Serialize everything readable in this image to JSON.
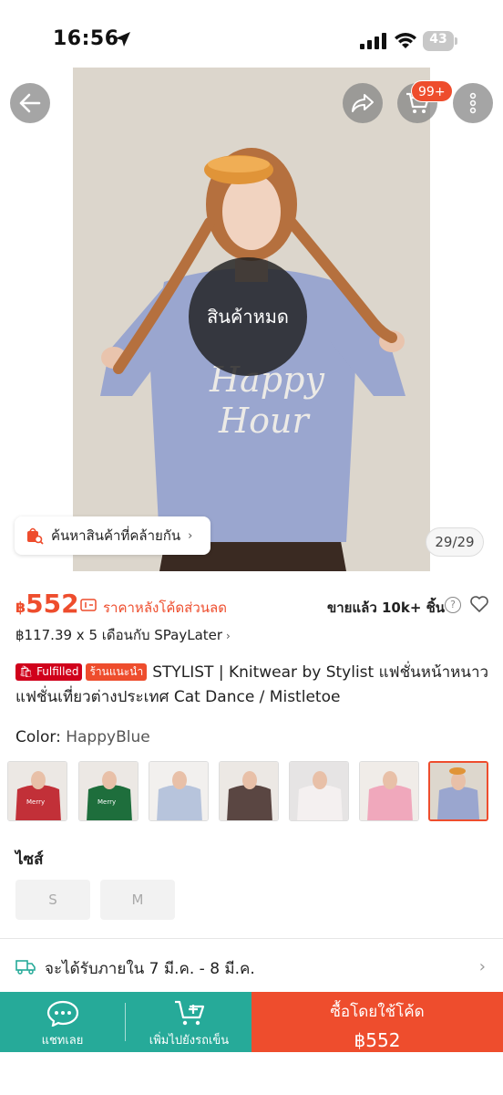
{
  "status": {
    "time": "16:56",
    "battery": "43"
  },
  "header": {
    "cart_badge": "99+"
  },
  "image": {
    "soldout_text": "สินค้าหมด",
    "similar_search": "ค้นหาสินค้าที่คล้ายกัน",
    "counter": "29/29"
  },
  "price": {
    "currency": "฿",
    "amount": "552",
    "after_code_label": "ราคาหลังโค้ดส่วนลด",
    "sold_text": "ขายแล้ว 10k+ ชิ้น",
    "installment": "฿117.39 x 5 เดือนกับ SPayLater"
  },
  "product": {
    "tag_fulfilled": "Fulfilled",
    "tag_recommended": "ร้านแนะนำ",
    "title": "STYLIST | Knitwear by Stylist แฟชั่นหน้าหนาว แฟชั่นเที่ยวต่างประเทศ Cat Dance / Mistletoe"
  },
  "variations": {
    "color_label": "Color:",
    "color_value": "HappyBlue",
    "size_label": "ไซส์",
    "sizes": [
      "S",
      "M"
    ]
  },
  "delivery": {
    "text": "จะได้รับภายใน 7 มี.ค. - 8 มี.ค."
  },
  "bottom_bar": {
    "chat_label": "แชทเลย",
    "add_cart_label": "เพิ่มไปยังรถเข็น",
    "buy_line1": "ซื้อโดยใช้โค้ด",
    "buy_line2": "฿552"
  },
  "colors": {
    "accent": "#ee4d2d",
    "teal": "#26aa99"
  }
}
